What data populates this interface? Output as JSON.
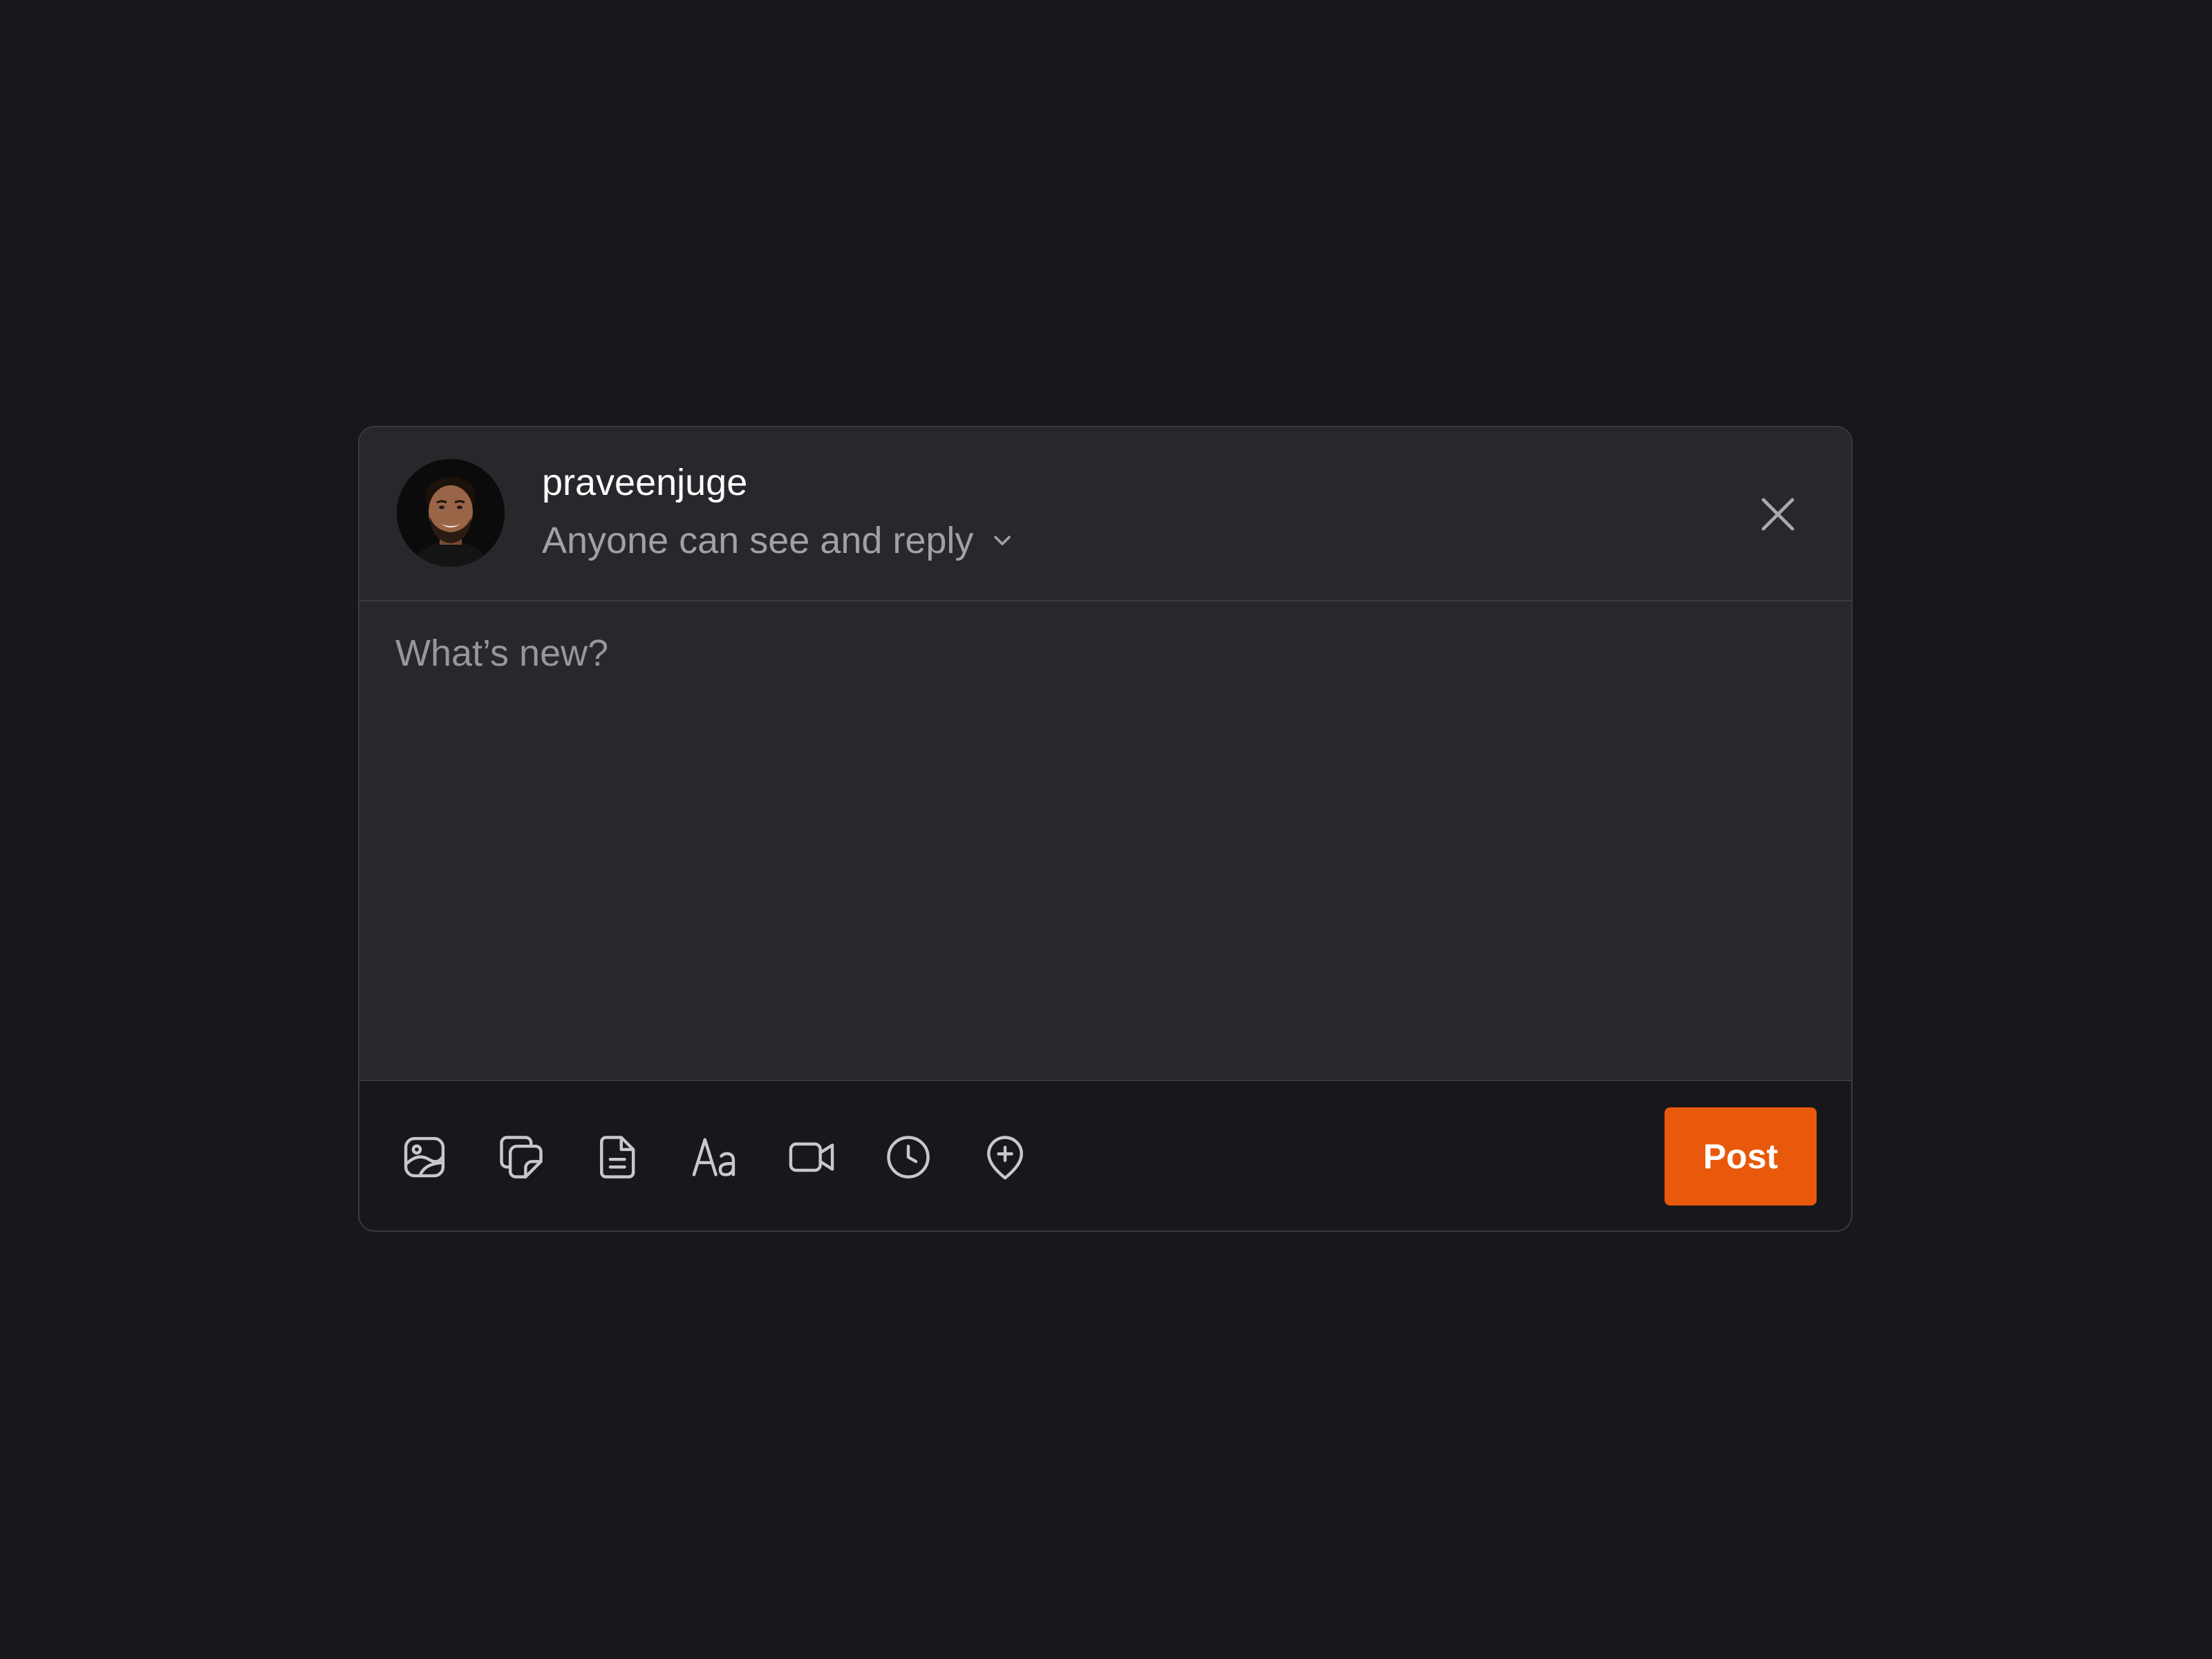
{
  "composer": {
    "username": "praveenjuge",
    "audience": "Anyone can see and reply",
    "placeholder": "What’s new?",
    "post_label": "Post",
    "accent_color": "#e8590c",
    "tools": [
      {
        "icon": "image-icon"
      },
      {
        "icon": "sticker-icon"
      },
      {
        "icon": "document-icon"
      },
      {
        "icon": "text-format-icon",
        "label": "Aa"
      },
      {
        "icon": "video-icon"
      },
      {
        "icon": "clock-icon"
      },
      {
        "icon": "location-add-icon"
      }
    ]
  }
}
